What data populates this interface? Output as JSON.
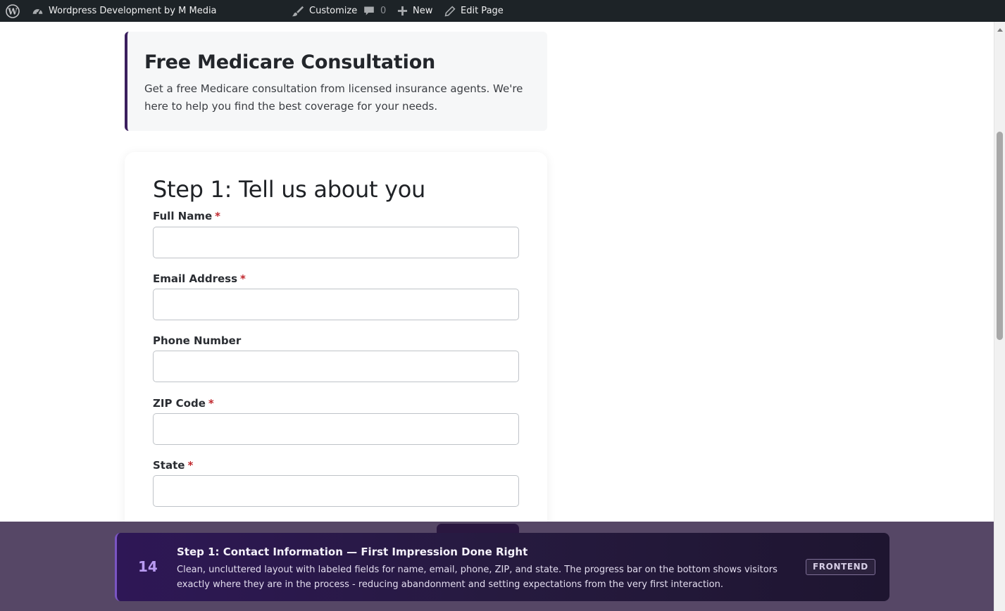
{
  "admin_bar": {
    "site_name": "Wordpress Development by M Media",
    "customize_label": "Customize",
    "comments_count": "0",
    "new_label": "New",
    "edit_page_label": "Edit Page"
  },
  "intro": {
    "title": "Free Medicare Consultation",
    "description": "Get a free Medicare consultation from licensed insurance agents. We're here to help you find the best coverage for your needs."
  },
  "form": {
    "step_title": "Step 1: Tell us about you",
    "required_mark": "*",
    "fields": [
      {
        "label": "Full Name",
        "required": true,
        "value": ""
      },
      {
        "label": "Email Address",
        "required": true,
        "value": ""
      },
      {
        "label": "Phone Number",
        "required": false,
        "value": ""
      },
      {
        "label": "ZIP Code",
        "required": true,
        "value": ""
      },
      {
        "label": "State",
        "required": true,
        "value": ""
      }
    ]
  },
  "banner": {
    "number": "14",
    "title": "Step 1: Contact Information — First Impression Done Right",
    "body": "Clean, uncluttered layout with labeled fields for name, email, phone, ZIP, and state. The progress bar on the bottom shows visitors exactly where they are in the process - reducing abandonment and setting expectations from the very first interaction.",
    "badge": "FRONTEND"
  },
  "icons": {
    "wp_logo": "wordpress-icon",
    "site": "dashboard-icon",
    "customize": "brush-icon",
    "comments": "comment-icon",
    "new": "plus-icon",
    "edit": "pencil-icon"
  },
  "colors": {
    "admin_bar": "#1d2327",
    "accent_purple": "#3b1f5e",
    "required": "#c0272d",
    "banner_number": "#b99bf2"
  }
}
